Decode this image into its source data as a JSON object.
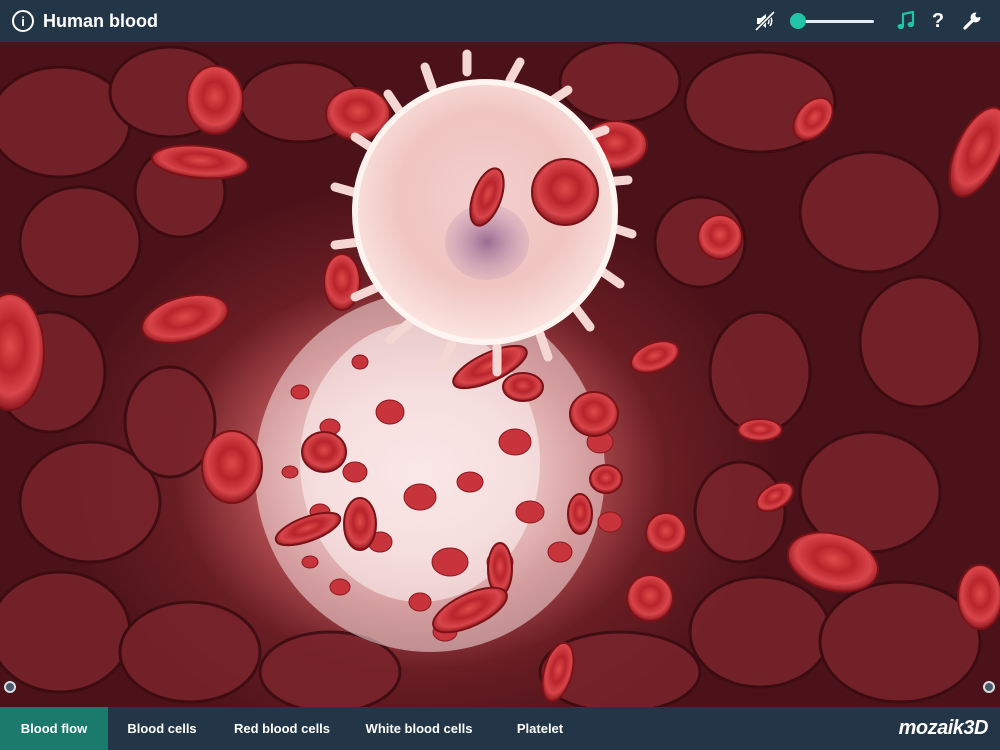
{
  "header": {
    "title": "Human blood",
    "info_glyph": "i",
    "help_glyph": "?",
    "icons": [
      "info-icon",
      "mute-icon",
      "music-icon",
      "help-icon",
      "wrench-icon"
    ],
    "volume": 0.0,
    "accent_color": "#20c5a9"
  },
  "tabs": [
    {
      "label": "Blood flow",
      "active": true
    },
    {
      "label": "Blood cells",
      "active": false
    },
    {
      "label": "Red blood cells",
      "active": false
    },
    {
      "label": "White blood cells",
      "active": false
    },
    {
      "label": "Platelet",
      "active": false
    }
  ],
  "logo": {
    "text": "mozaik3D"
  },
  "colors": {
    "bar_background": "#233647",
    "active_tab": "#1c7a6c",
    "accent": "#20c5a9"
  }
}
